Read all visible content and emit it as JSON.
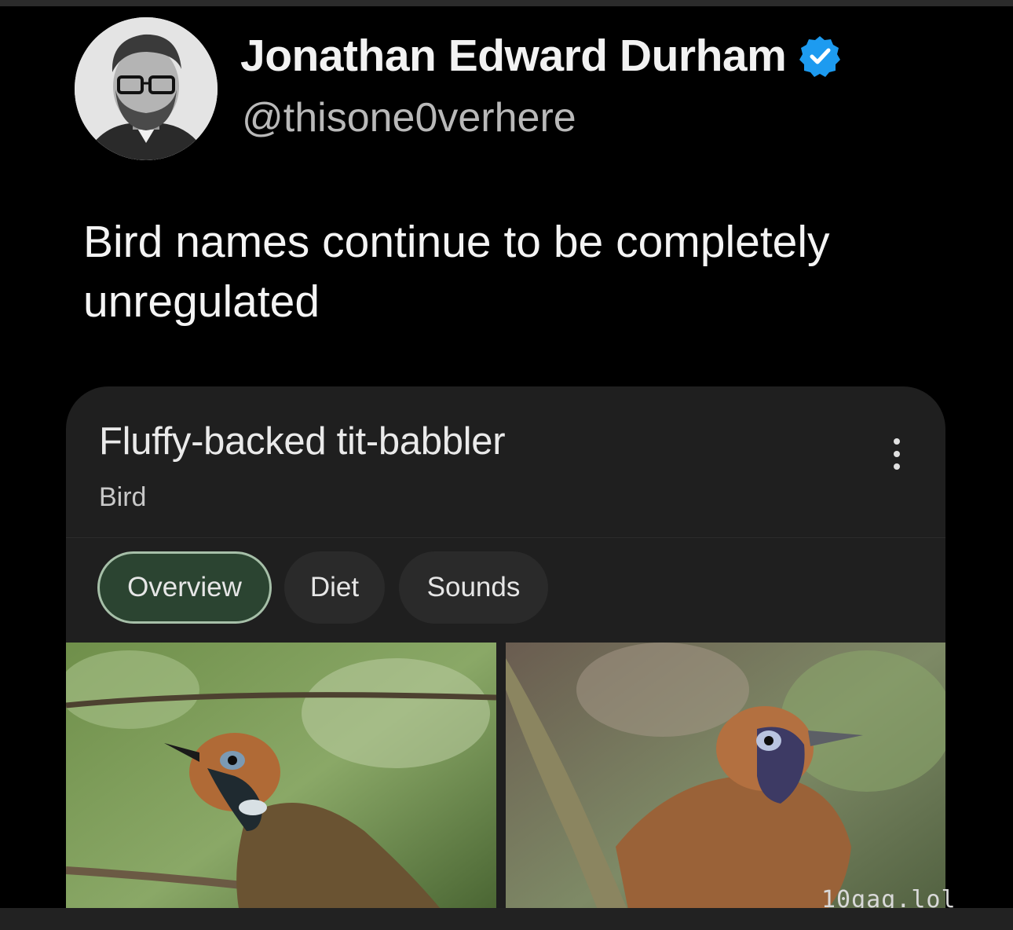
{
  "tweet": {
    "author_name": "Jonathan Edward Durham",
    "handle": "@thisone0verhere",
    "verified": true,
    "text": "Bird names continue to be completely unregulated"
  },
  "card": {
    "title": "Fluffy-backed tit-babbler",
    "subtitle": "Bird",
    "tabs": [
      {
        "label": "Overview",
        "selected": true
      },
      {
        "label": "Diet",
        "selected": false
      },
      {
        "label": "Sounds",
        "selected": false
      }
    ],
    "images": [
      "bird-photo",
      "bird-photo"
    ]
  },
  "watermark": "10gag.lol",
  "colors": {
    "background": "#000000",
    "card": "#1f1f1f",
    "selected_tab": "#2b4431",
    "verified": "#1d9bf0"
  },
  "icons": [
    "verified-badge-icon",
    "more-vertical-icon"
  ]
}
